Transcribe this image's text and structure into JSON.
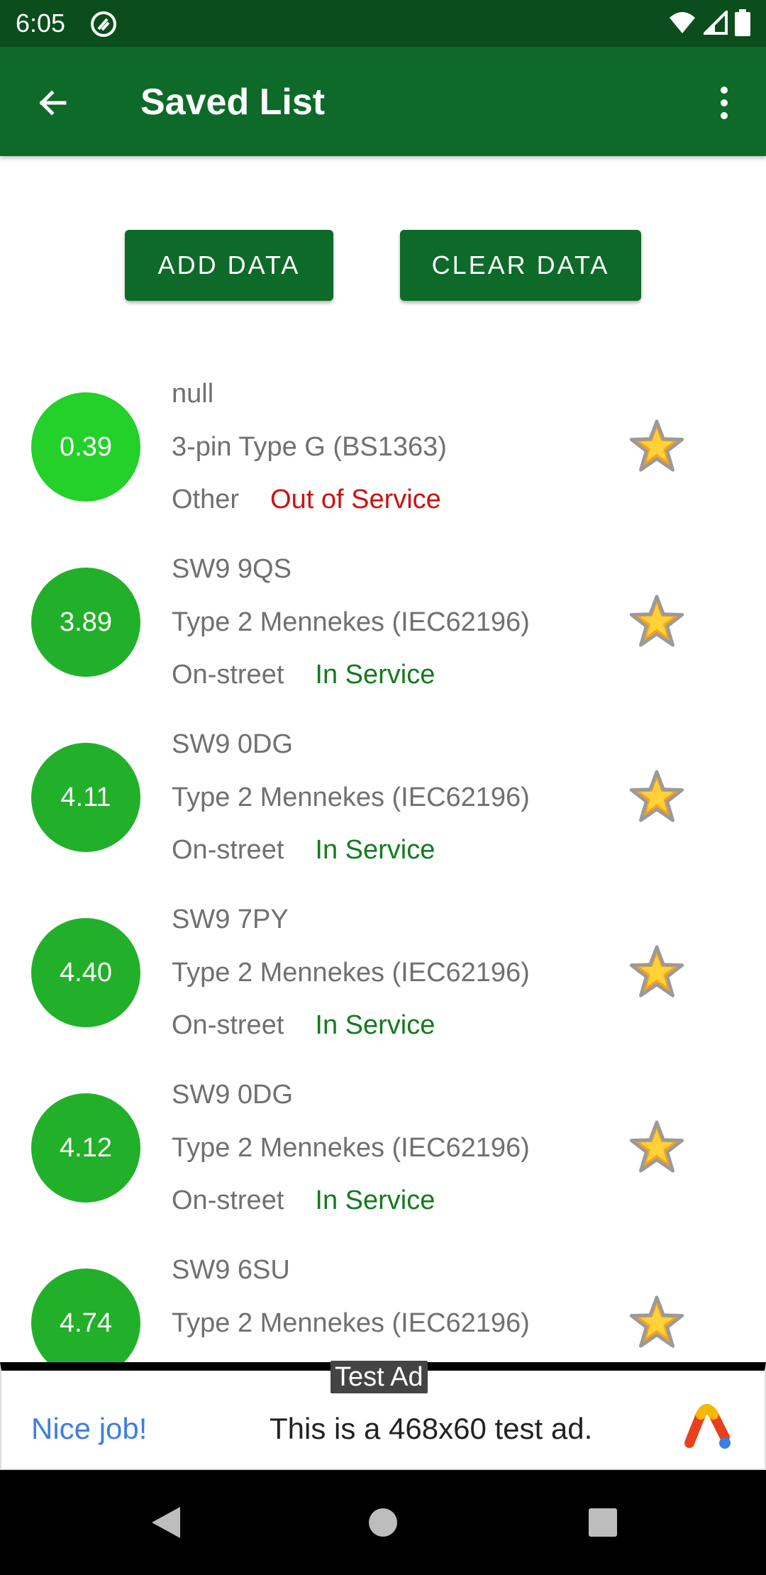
{
  "status_bar": {
    "time": "6:05"
  },
  "app_bar": {
    "title": "Saved List"
  },
  "actions": {
    "add_label": "ADD DATA",
    "clear_label": "CLEAR DATA"
  },
  "items": [
    {
      "distance": "0.39",
      "postcode": "null",
      "connector": "3-pin Type G (BS1363)",
      "location": "Other",
      "status": "Out of Service"
    },
    {
      "distance": "3.89",
      "postcode": "SW9 9QS",
      "connector": "Type 2 Mennekes (IEC62196)",
      "location": "On-street",
      "status": "In Service"
    },
    {
      "distance": "4.11",
      "postcode": "SW9 0DG",
      "connector": "Type 2 Mennekes (IEC62196)",
      "location": "On-street",
      "status": "In Service"
    },
    {
      "distance": "4.40",
      "postcode": "SW9 7PY",
      "connector": "Type 2 Mennekes (IEC62196)",
      "location": "On-street",
      "status": "In Service"
    },
    {
      "distance": "4.12",
      "postcode": "SW9 0DG",
      "connector": "Type 2 Mennekes (IEC62196)",
      "location": "On-street",
      "status": "In Service"
    },
    {
      "distance": "4.74",
      "postcode": "SW9 6SU",
      "connector": "Type 2 Mennekes (IEC62196)",
      "location": "",
      "status": ""
    }
  ],
  "ad": {
    "label": "Test Ad",
    "headline": "Nice job!",
    "body": "This is a 468x60 test ad."
  },
  "colors": {
    "app_bar": "#0d6a28",
    "status_bar": "#0b4d1c",
    "distance_circle": "#22b02a",
    "in_service": "#137a1f",
    "out_of_service": "#cc1111"
  },
  "icons": {
    "back": "arrow-left-icon",
    "overflow": "more-vert-icon",
    "favorite": "star-icon",
    "wifi": "wifi-icon",
    "signal": "signal-icon",
    "battery": "battery-icon"
  }
}
